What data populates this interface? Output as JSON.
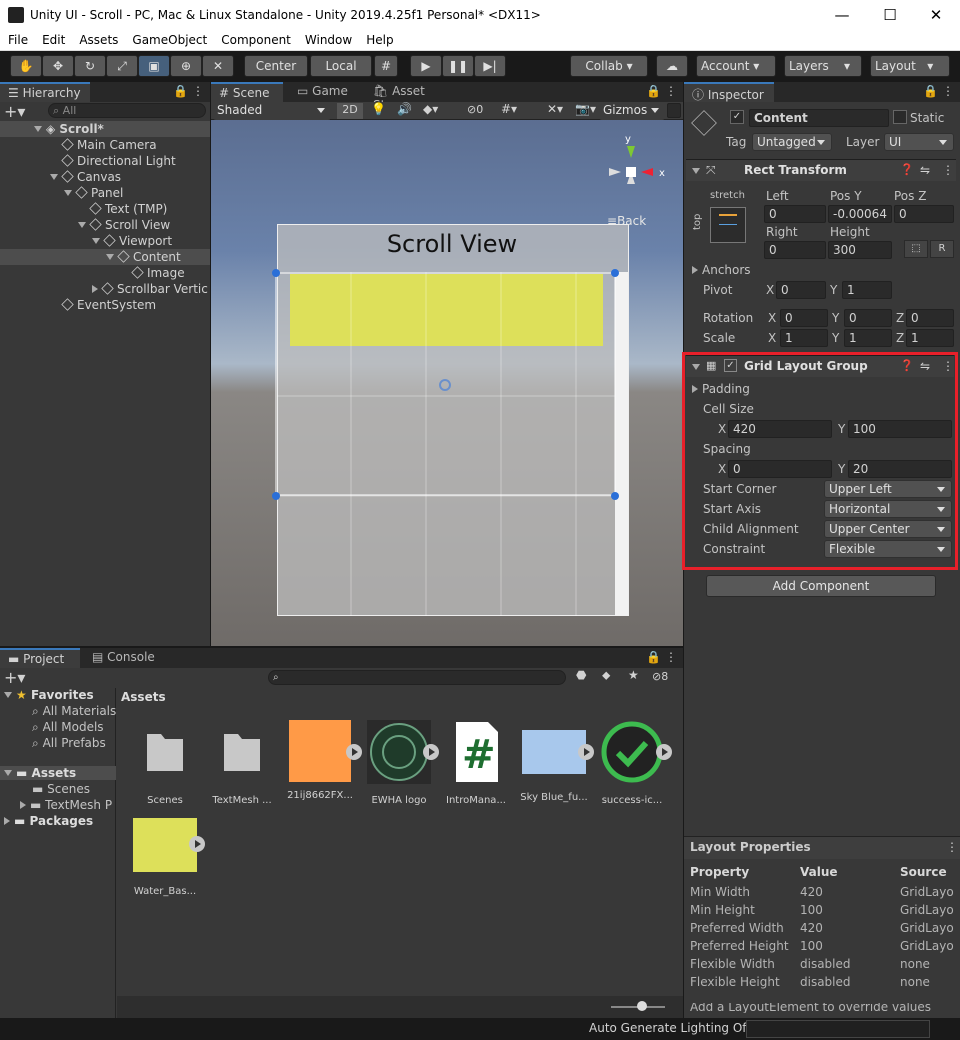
{
  "window": {
    "title": "Unity UI - Scroll - PC, Mac & Linux Standalone - Unity 2019.4.25f1 Personal* <DX11>",
    "minimize": "—",
    "maximize": "☐",
    "close": "✕"
  },
  "menu": [
    "File",
    "Edit",
    "Assets",
    "GameObject",
    "Component",
    "Window",
    "Help"
  ],
  "toolbar": {
    "pivot": "Center",
    "space": "Local",
    "collab": "Collab",
    "account": "Account",
    "layers": "Layers",
    "layout": "Layout"
  },
  "hierarchy": {
    "tab": "Hierarchy",
    "search_placeholder": "All",
    "scene": "Scroll*",
    "items": [
      "Main Camera",
      "Directional Light",
      "Canvas",
      "Panel",
      "Text (TMP)",
      "Scroll View",
      "Viewport",
      "Content",
      "Image",
      "Scrollbar Vertic",
      "EventSystem"
    ]
  },
  "scene_view": {
    "tabs": [
      "Scene",
      "Game",
      "Asset Store"
    ],
    "shading": "Shaded",
    "mode2d": "2D",
    "hidden_count": "0",
    "gizmos": "Gizmos",
    "back": "Back",
    "title_text": "Scroll View",
    "axis_y": "y",
    "axis_x": "x"
  },
  "inspector": {
    "tab": "Inspector",
    "object_name": "Content",
    "static": "Static",
    "tag_label": "Tag",
    "tag": "Untagged",
    "layer_label": "Layer",
    "layer": "UI",
    "rect": {
      "title": "Rect Transform",
      "stretch": "stretch",
      "top": "top",
      "left_l": "Left",
      "posy_l": "Pos Y",
      "posz_l": "Pos Z",
      "left": "0",
      "posy": "-0.00064",
      "posz": "0",
      "right_l": "Right",
      "height_l": "Height",
      "right": "0",
      "height": "300",
      "r": "R",
      "anchors": "Anchors",
      "pivot": "Pivot",
      "px": "0",
      "py": "1",
      "rotation": "Rotation",
      "rx": "0",
      "ry": "0",
      "rz": "0",
      "scale": "Scale",
      "sx": "1",
      "sy": "1",
      "sz": "1",
      "xl": "X",
      "yl": "Y",
      "zl": "Z"
    },
    "grid": {
      "title": "Grid Layout Group",
      "padding": "Padding",
      "cell_size": "Cell Size",
      "cx": "420",
      "cy": "100",
      "spacing": "Spacing",
      "spx": "0",
      "spy": "20",
      "start_corner_l": "Start Corner",
      "start_corner": "Upper Left",
      "start_axis_l": "Start Axis",
      "start_axis": "Horizontal",
      "child_align_l": "Child Alignment",
      "child_align": "Upper Center",
      "constraint_l": "Constraint",
      "constraint": "Flexible",
      "xl": "X",
      "yl": "Y"
    },
    "add_component": "Add Component",
    "layout_props": {
      "title": "Layout Properties",
      "headers": [
        "Property",
        "Value",
        "Source"
      ],
      "rows": [
        [
          "Min Width",
          "420",
          "GridLayo"
        ],
        [
          "Min Height",
          "100",
          "GridLayo"
        ],
        [
          "Preferred Width",
          "420",
          "GridLayo"
        ],
        [
          "Preferred Height",
          "100",
          "GridLayo"
        ],
        [
          "Flexible Width",
          "disabled",
          "none"
        ],
        [
          "Flexible Height",
          "disabled",
          "none"
        ]
      ],
      "footer": "Add a LayoutElement to override values"
    }
  },
  "project": {
    "tabs": [
      "Project",
      "Console"
    ],
    "hidden_count": "8",
    "favorites": "Favorites",
    "fav_items": [
      "All Materials",
      "All Models",
      "All Prefabs"
    ],
    "assets": "Assets",
    "asset_folders": [
      "Scenes",
      "TextMesh P"
    ],
    "packages": "Packages",
    "breadcrumb": "Assets",
    "files": [
      {
        "name": "Scenes",
        "color": "#c8c8c8"
      },
      {
        "name": "TextMesh ...",
        "color": "#c8c8c8"
      },
      {
        "name": "21ij8662FX...",
        "color": "#ff9a47"
      },
      {
        "name": "EWHA logo",
        "color": "#1f3b2a"
      },
      {
        "name": "IntroMana...",
        "color": "#ffffff"
      },
      {
        "name": "Sky Blue_fu...",
        "color": "#a8c8ec"
      },
      {
        "name": "success-ic...",
        "color": "#3dbb4f"
      },
      {
        "name": "Water_Bas...",
        "color": "#dde05a"
      }
    ]
  },
  "status": {
    "text": "Auto Generate Lighting Off"
  },
  "colors": {
    "highlight": "#e8202a",
    "yellow": "#dde05a",
    "accent": "#3a79bb"
  }
}
